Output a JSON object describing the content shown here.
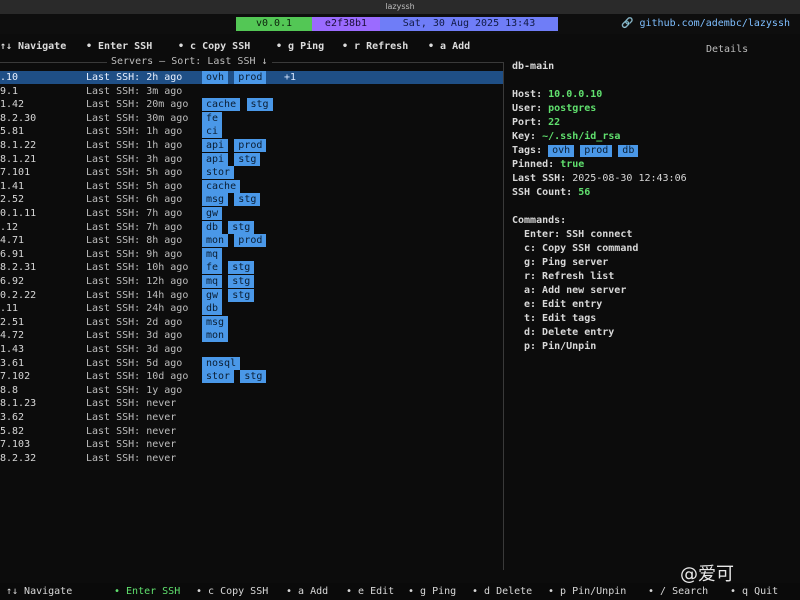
{
  "window": {
    "title": "lazyssh"
  },
  "status": {
    "version": "v0.0.1",
    "commit": "e2f38b1",
    "date": "Sat, 30 Aug 2025 13:43",
    "repo": "github.com/adembc/lazyssh"
  },
  "hints_top": [
    {
      "text": "↑↓ Navigate"
    },
    {
      "text": "• Enter SSH"
    },
    {
      "text": "• c Copy SSH"
    },
    {
      "text": "• g Ping"
    },
    {
      "text": "• r Refresh"
    },
    {
      "text": "• a Add"
    }
  ],
  "panels": {
    "servers_title": "Servers — Sort: Last SSH ↓",
    "details_title": "Details"
  },
  "servers": [
    {
      "ip": ".10",
      "ssh": "Last SSH: 2h ago",
      "tags": [
        "ovh",
        "prod"
      ],
      "pinned": "+1"
    },
    {
      "ip": "9.1",
      "ssh": "Last SSH: 3m ago",
      "tags": []
    },
    {
      "ip": "1.42",
      "ssh": "Last SSH: 20m ago",
      "tags": [
        "cache",
        "stg"
      ]
    },
    {
      "ip": "8.2.30",
      "ssh": "Last SSH: 30m ago",
      "tags": [
        "fe"
      ]
    },
    {
      "ip": "5.81",
      "ssh": "Last SSH: 1h ago",
      "tags": [
        "ci"
      ]
    },
    {
      "ip": "8.1.22",
      "ssh": "Last SSH: 1h ago",
      "tags": [
        "api",
        "prod"
      ]
    },
    {
      "ip": "8.1.21",
      "ssh": "Last SSH: 3h ago",
      "tags": [
        "api",
        "stg"
      ]
    },
    {
      "ip": "7.101",
      "ssh": "Last SSH: 5h ago",
      "tags": [
        "stor"
      ]
    },
    {
      "ip": "1.41",
      "ssh": "Last SSH: 5h ago",
      "tags": [
        "cache"
      ]
    },
    {
      "ip": "2.52",
      "ssh": "Last SSH: 6h ago",
      "tags": [
        "msg",
        "stg"
      ]
    },
    {
      "ip": "0.1.11",
      "ssh": "Last SSH: 7h ago",
      "tags": [
        "gw"
      ]
    },
    {
      "ip": ".12",
      "ssh": "Last SSH: 7h ago",
      "tags": [
        "db",
        "stg"
      ]
    },
    {
      "ip": "4.71",
      "ssh": "Last SSH: 8h ago",
      "tags": [
        "mon",
        "prod"
      ]
    },
    {
      "ip": "6.91",
      "ssh": "Last SSH: 9h ago",
      "tags": [
        "mq"
      ]
    },
    {
      "ip": "8.2.31",
      "ssh": "Last SSH: 10h ago",
      "tags": [
        "fe",
        "stg"
      ]
    },
    {
      "ip": "6.92",
      "ssh": "Last SSH: 12h ago",
      "tags": [
        "mq",
        "stg"
      ]
    },
    {
      "ip": "0.2.22",
      "ssh": "Last SSH: 14h ago",
      "tags": [
        "gw",
        "stg"
      ]
    },
    {
      "ip": ".11",
      "ssh": "Last SSH: 24h ago",
      "tags": [
        "db"
      ]
    },
    {
      "ip": "2.51",
      "ssh": "Last SSH: 2d ago",
      "tags": [
        "msg"
      ]
    },
    {
      "ip": "4.72",
      "ssh": "Last SSH: 3d ago",
      "tags": [
        "mon"
      ]
    },
    {
      "ip": "1.43",
      "ssh": "Last SSH: 3d ago",
      "tags": []
    },
    {
      "ip": "3.61",
      "ssh": "Last SSH: 5d ago",
      "tags": [
        "nosql"
      ]
    },
    {
      "ip": "7.102",
      "ssh": "Last SSH: 10d ago",
      "tags": [
        "stor",
        "stg"
      ]
    },
    {
      "ip": "8.8",
      "ssh": "Last SSH: 1y ago",
      "tags": []
    },
    {
      "ip": "8.1.23",
      "ssh": "Last SSH: never",
      "tags": []
    },
    {
      "ip": "3.62",
      "ssh": "Last SSH: never",
      "tags": []
    },
    {
      "ip": "5.82",
      "ssh": "Last SSH: never",
      "tags": []
    },
    {
      "ip": "7.103",
      "ssh": "Last SSH: never",
      "tags": []
    },
    {
      "ip": "8.2.32",
      "ssh": "Last SSH: never",
      "tags": []
    }
  ],
  "details": {
    "name": "db-main",
    "host_label": "Host:",
    "host": "10.0.0.10",
    "user_label": "User:",
    "user": "postgres",
    "port_label": "Port:",
    "port": "22",
    "key_label": "Key:",
    "key": "~/.ssh/id_rsa",
    "tags_label": "Tags:",
    "tags": [
      "ovh",
      "prod",
      "db"
    ],
    "pinned_label": "Pinned:",
    "pinned": "true",
    "lastssh_label": "Last SSH:",
    "lastssh": "2025-08-30 12:43:06",
    "count_label": "SSH Count:",
    "count": "56",
    "commands_title": "Commands:",
    "commands": [
      "Enter: SSH connect",
      "c: Copy SSH command",
      "g: Ping server",
      "r: Refresh list",
      "a: Add new server",
      "e: Edit entry",
      "t: Edit tags",
      "d: Delete entry",
      "p: Pin/Unpin"
    ]
  },
  "footer": [
    {
      "text": "↑↓ Navigate"
    },
    {
      "text": "• Enter SSH"
    },
    {
      "text": "• c Copy SSH"
    },
    {
      "text": "• a Add"
    },
    {
      "text": "• e Edit"
    },
    {
      "text": "• g Ping"
    },
    {
      "text": "• d Delete"
    },
    {
      "text": "• p Pin/Unpin"
    },
    {
      "text": "• / Search"
    },
    {
      "text": "• q Quit"
    }
  ],
  "watermark": "@爱可",
  "colors": {
    "accent": "#4a98e8",
    "selected": "#1f4f86",
    "green": "#60e06e"
  }
}
